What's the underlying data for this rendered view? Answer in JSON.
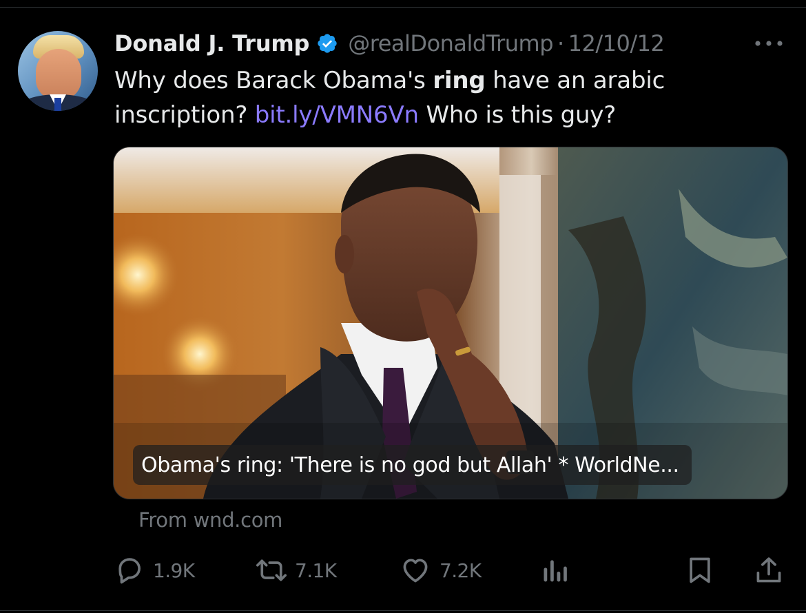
{
  "tweet": {
    "author": {
      "display_name": "Donald J. Trump",
      "handle": "@realDonaldTrump",
      "verified": true
    },
    "separator": "·",
    "date": "12/10/12",
    "text": {
      "part1": "Why does Barack Obama's ",
      "bold": "ring",
      "part2": " have an arabic inscription? ",
      "link": "bit.ly/VMN6Vn",
      "part3": " Who is this guy?"
    },
    "card": {
      "title": "Obama's ring: 'There is no god but Allah' * WorldNe...",
      "source": "From wnd.com"
    },
    "actions": {
      "replies": "1.9K",
      "reposts": "7.1K",
      "likes": "7.2K"
    }
  },
  "icons": {
    "more": "more-icon",
    "verified": "verified-badge-icon",
    "reply": "reply-icon",
    "repost": "repost-icon",
    "like": "heart-icon",
    "views": "views-icon",
    "bookmark": "bookmark-icon",
    "share": "share-icon"
  },
  "colors": {
    "background": "#000000",
    "text": "#e7e9ea",
    "muted": "#71767b",
    "link": "#8b7bff",
    "verified": "#1d9bf0"
  }
}
